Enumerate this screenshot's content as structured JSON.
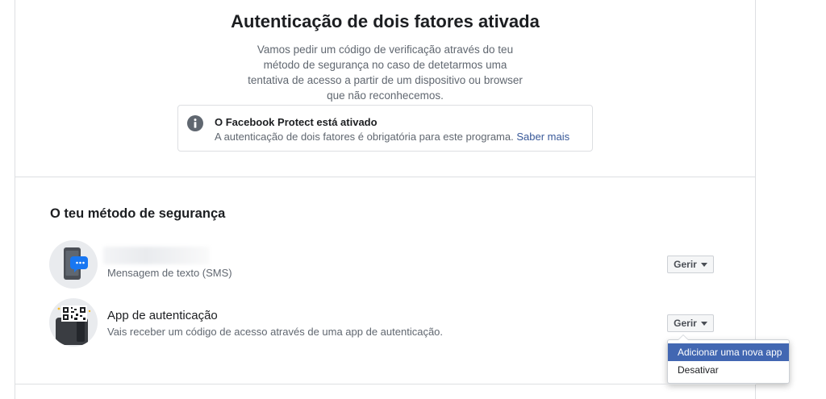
{
  "header": {
    "title": "Autenticação de dois fatores ativada",
    "description": "Vamos pedir um código de verificação através do teu método de segurança no caso de detetarmos uma tentativa de acesso a partir de um dispositivo ou browser que não reconhecemos."
  },
  "protect": {
    "icon": "info-icon",
    "title": "O Facebook Protect está ativado",
    "text": "A autenticação de dois fatores é obrigatória para este programa. ",
    "link": "Saber mais"
  },
  "security": {
    "section_title": "O teu método de segurança",
    "methods": [
      {
        "icon": "phone-sms-icon",
        "name": "",
        "subtitle": "Mensagem de texto (SMS)",
        "button": "Gerir"
      },
      {
        "icon": "qr-authenticator-icon",
        "name": "App de autenticação",
        "subtitle": "Vais receber um código de acesso através de uma app de autenticação.",
        "button": "Gerir"
      }
    ]
  },
  "dropdown": {
    "items": [
      "Adicionar uma nova app",
      "Desativar"
    ],
    "highlighted_index": 0
  },
  "colors": {
    "link": "#385898",
    "highlight": "#4267b2",
    "sms_accent": "#1877f2"
  }
}
